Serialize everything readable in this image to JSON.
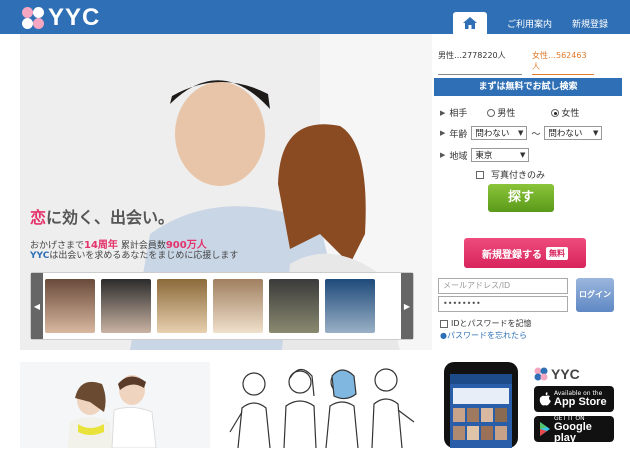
{
  "header": {
    "logo_text": "YYC",
    "nav": [
      "ご利用案内",
      "新規登録"
    ]
  },
  "hero": {
    "tagline_red": "恋",
    "tagline_rest": "に効く、出会い。",
    "sub1_prefix": "おかげさまで",
    "sub1_years": "14周年",
    "sub1_middle": "累計会員数",
    "sub1_members": "900万人",
    "sub2_brand": "YYC",
    "sub2_rest": "は出会いを求めるあなたをまじめに応援します"
  },
  "side": {
    "male_count": "男性…2778220人",
    "female_count": "女性…562463人",
    "search_title": "まずは無料でお試し検索",
    "gender_label": "相手",
    "male": "男性",
    "female": "女性",
    "age_label": "年齢",
    "age_from": "問わない",
    "age_to": "問わない",
    "tilde": "〜",
    "area_label": "地域",
    "area_value": "東京",
    "photo_only": "写真付きのみ",
    "search_btn": "探す",
    "register_btn": "新規登録する",
    "register_free": "無料",
    "email_placeholder": "メールアドレス/ID",
    "password_mask": "••••••••",
    "login_btn": "ログイン",
    "remember": "IDとパスワードを記憶",
    "forgot": "●パスワードを忘れたら"
  },
  "bottom": {
    "yyc_logo": "YYC",
    "appstore_small": "Available on the",
    "appstore_large": "App Store",
    "gplay_small": "GET IT ON",
    "gplay_large": "Google play"
  },
  "colors": {
    "brand_blue": "#2f6fb5",
    "pink": "#e4336b",
    "green": "#6aaa23"
  }
}
